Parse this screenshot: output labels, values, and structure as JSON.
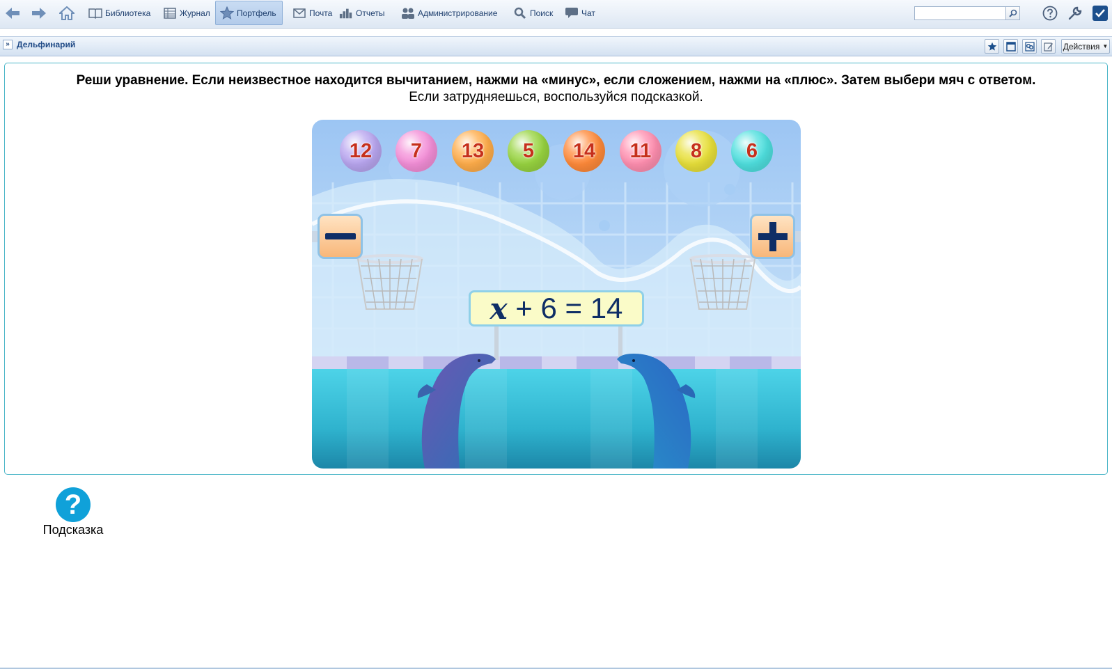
{
  "toolbar": {
    "items": [
      {
        "label": "Библиотека",
        "icon": "book-icon"
      },
      {
        "label": "Журнал",
        "icon": "journal-icon"
      },
      {
        "label": "Портфель",
        "icon": "star-icon",
        "active": true
      },
      {
        "label": "Почта",
        "icon": "mail-icon"
      },
      {
        "label": "Отчеты",
        "icon": "chart-icon"
      },
      {
        "label": "Администрирование",
        "icon": "admin-icon"
      },
      {
        "label": "Поиск",
        "icon": "search-icon"
      },
      {
        "label": "Чат",
        "icon": "chat-icon"
      }
    ],
    "search_value": ""
  },
  "subbar": {
    "breadcrumb_title": "Дельфинарий",
    "actions_label": "Действия"
  },
  "task": {
    "title": "Реши уравнение. Если неизвестное находится вычитанием, нажми на «минус», если сложением, нажми на «плюс». Затем выбери мяч с ответом.",
    "subtitle": "Если затрудняешься, воспользуйся подсказкой."
  },
  "game": {
    "balls": [
      {
        "value": "12",
        "color": "#b9a6f0"
      },
      {
        "value": "7",
        "color": "#f48fd8"
      },
      {
        "value": "13",
        "color": "#ffad4a"
      },
      {
        "value": "5",
        "color": "#98d440"
      },
      {
        "value": "14",
        "color": "#ff8a3a"
      },
      {
        "value": "11",
        "color": "#ff8fb0"
      },
      {
        "value": "8",
        "color": "#e8e03a"
      },
      {
        "value": "6",
        "color": "#4fe0df"
      }
    ],
    "minus_label": "−",
    "plus_label": "+",
    "equation": {
      "variable": "x",
      "rest": " + 6 = 14"
    }
  },
  "hint": {
    "label": "Подсказка",
    "icon_glyph": "?"
  },
  "colors": {
    "accent": "#1f4a86",
    "panel_border": "#4cb6c8",
    "hint_blue": "#10a1d9",
    "ball_text": "#c6301c"
  }
}
